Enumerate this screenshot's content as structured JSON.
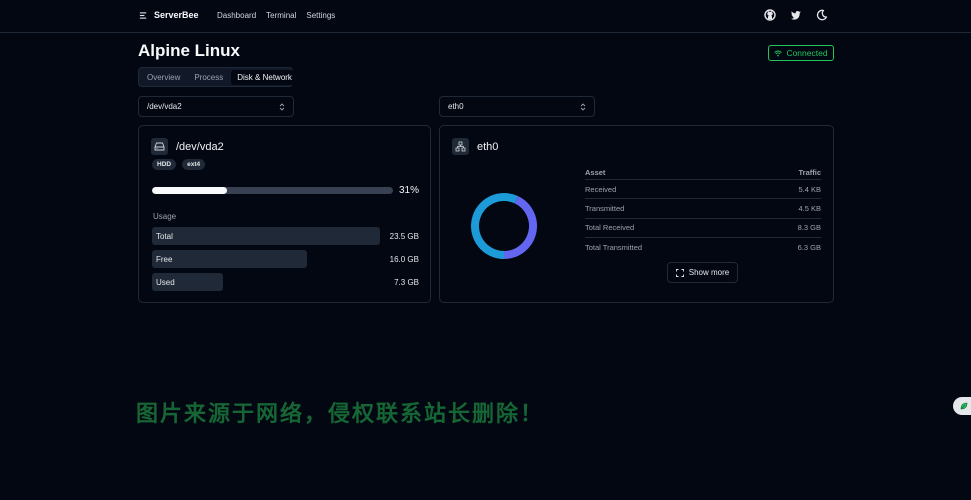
{
  "app": {
    "name": "ServerBee",
    "nav": [
      "Dashboard",
      "Terminal",
      "Settings"
    ]
  },
  "header": {
    "icons": [
      "github-icon",
      "twitter-icon",
      "moon-icon"
    ]
  },
  "page": {
    "title": "Alpine Linux",
    "status": "Connected",
    "tabs": [
      {
        "label": "Overview",
        "active": false
      },
      {
        "label": "Process",
        "active": false
      },
      {
        "label": "Disk & Network",
        "active": true
      }
    ]
  },
  "disk": {
    "select_value": "/dev/vda2",
    "title": "/dev/vda2",
    "chips": [
      "HDD",
      "ext4"
    ],
    "usage_percent": 31,
    "usage_percent_label": "31%",
    "usage_label": "Usage",
    "rows": [
      {
        "name": "Total",
        "value": "23.5 GB",
        "fraction": 1.0
      },
      {
        "name": "Free",
        "value": "16.0 GB",
        "fraction": 0.68
      },
      {
        "name": "Used",
        "value": "7.3 GB",
        "fraction": 0.31
      }
    ]
  },
  "network": {
    "select_value": "eth0",
    "title": "eth0",
    "table": {
      "col_asset": "Asset",
      "col_traffic": "Traffic",
      "rows": [
        {
          "asset": "Received",
          "traffic": "5.4 KB"
        },
        {
          "asset": "Transmitted",
          "traffic": "4.5 KB"
        },
        {
          "asset": "Total Received",
          "traffic": "8.3 GB"
        },
        {
          "asset": "Total Transmitted",
          "traffic": "6.3 GB"
        }
      ]
    },
    "donut": [
      {
        "key": "total_received",
        "value": 8.3,
        "color": "#1d9bd9"
      },
      {
        "key": "total_transmitted",
        "value": 6.3,
        "color": "#6366f1"
      }
    ],
    "show_more": "Show more"
  },
  "watermark": "图片来源于网络，侵权联系站长删除！",
  "colors": {
    "background": "#030712",
    "accent_green": "#22c55e",
    "donut_blue": "#1d9bd9",
    "donut_indigo": "#6366f1"
  }
}
